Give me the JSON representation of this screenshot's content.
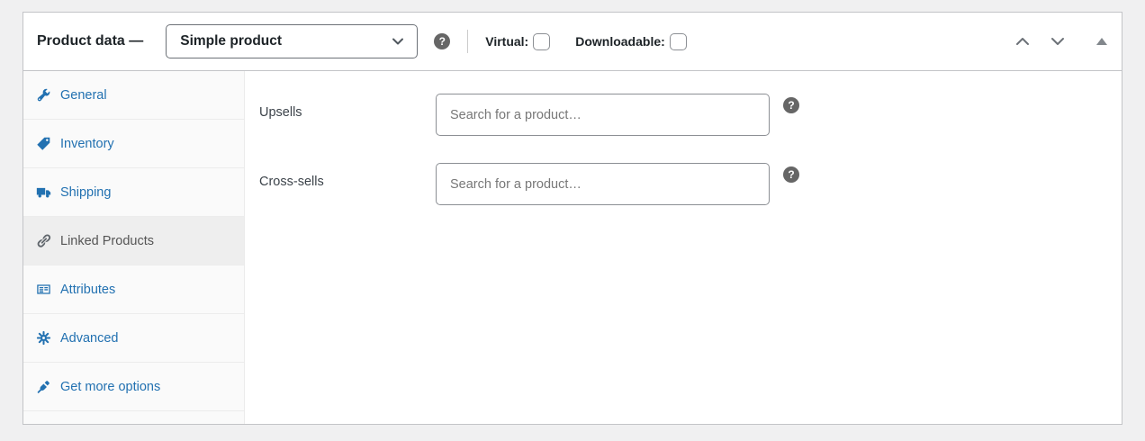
{
  "header": {
    "title": "Product data —",
    "product_type": {
      "value": "Simple product",
      "chevron_icon": "chevron-down-icon"
    },
    "help_glyph": "?",
    "virtual": {
      "label": "Virtual:",
      "checked": false
    },
    "downloadable": {
      "label": "Downloadable:",
      "checked": false
    },
    "controls": {
      "move_up_icon": "chevron-up-icon",
      "move_down_icon": "chevron-down-icon",
      "toggle_icon": "triangle-up-icon"
    }
  },
  "sidebar": {
    "items": [
      {
        "label": "General",
        "icon": "wrench-icon",
        "active": false
      },
      {
        "label": "Inventory",
        "icon": "tag-icon",
        "active": false
      },
      {
        "label": "Shipping",
        "icon": "truck-icon",
        "active": false
      },
      {
        "label": "Linked Products",
        "icon": "link-icon",
        "active": true
      },
      {
        "label": "Attributes",
        "icon": "card-icon",
        "active": false
      },
      {
        "label": "Advanced",
        "icon": "gear-icon",
        "active": false
      },
      {
        "label": "Get more options",
        "icon": "plug-icon",
        "active": false
      }
    ]
  },
  "panel": {
    "fields": [
      {
        "label": "Upsells",
        "placeholder": "Search for a product…",
        "value": "",
        "help_glyph": "?"
      },
      {
        "label": "Cross-sells",
        "placeholder": "Search for a product…",
        "value": "",
        "help_glyph": "?"
      }
    ]
  },
  "colors": {
    "accent_blue": "#2271b1",
    "page_bg": "#f0f0f1",
    "box_border": "#c3c4c7",
    "active_tab_bg": "#eeeeee",
    "active_tab_text": "#555555",
    "help_icon_bg": "#666666",
    "input_border": "#8c8f94"
  }
}
